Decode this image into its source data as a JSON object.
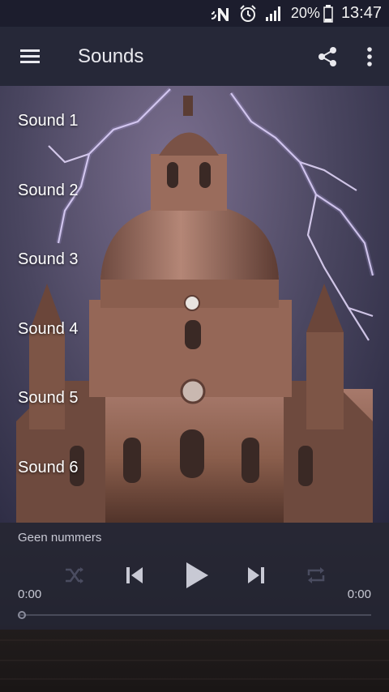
{
  "status_bar": {
    "battery_text": "20%",
    "time": "13:47",
    "icons": [
      "nfc-icon",
      "alarm-icon",
      "signal-icon",
      "battery-icon"
    ]
  },
  "app_bar": {
    "title": "Sounds",
    "icons": [
      "menu-icon",
      "share-icon",
      "more-vert-icon"
    ]
  },
  "sounds": [
    {
      "label": "Sound 1"
    },
    {
      "label": "Sound 2"
    },
    {
      "label": "Sound 3"
    },
    {
      "label": "Sound 4"
    },
    {
      "label": "Sound 5"
    },
    {
      "label": "Sound 6"
    }
  ],
  "player": {
    "track_text": "Geen nummers",
    "time_current": "0:00",
    "time_total": "0:00",
    "progress": 0,
    "icons": [
      "shuffle-icon",
      "previous-icon",
      "play-icon",
      "next-icon",
      "repeat-icon"
    ]
  },
  "colors": {
    "status_bar": "#1c1d2d",
    "app_bar": "#262838",
    "player_bg": "#26283a"
  }
}
